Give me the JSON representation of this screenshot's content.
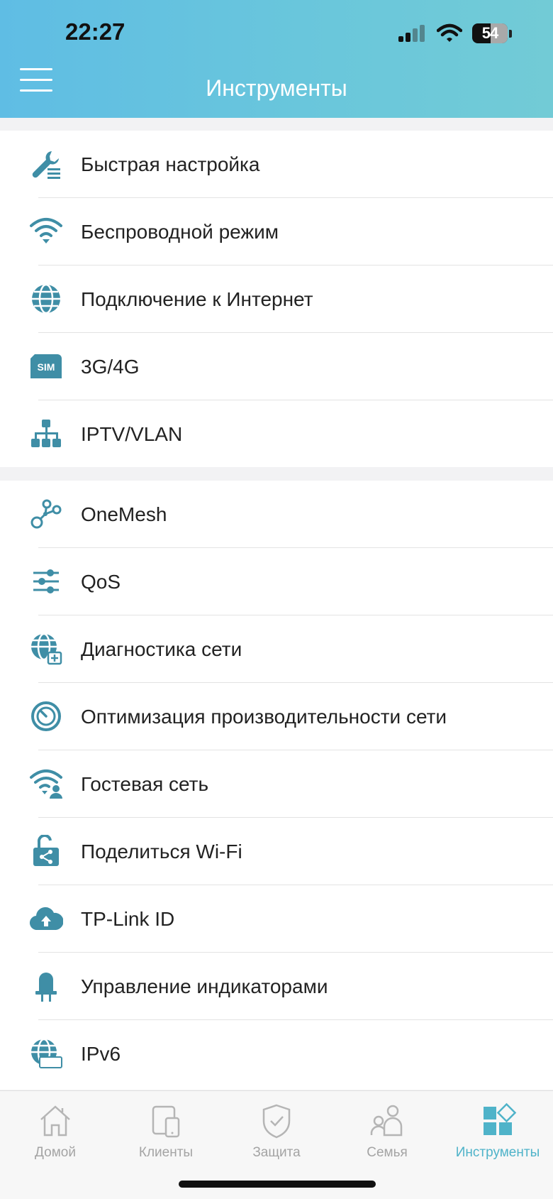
{
  "status_bar": {
    "time": "22:27",
    "battery": "54"
  },
  "header": {
    "title": "Инструменты"
  },
  "group1": [
    {
      "label": "Быстрая настройка",
      "icon": "wrench-settings-icon"
    },
    {
      "label": "Беспроводной режим",
      "icon": "wifi-icon"
    },
    {
      "label": "Подключение к Интернет",
      "icon": "globe-icon"
    },
    {
      "label": "3G/4G",
      "icon": "sim-card-icon"
    },
    {
      "label": "IPTV/VLAN",
      "icon": "network-tree-icon"
    }
  ],
  "group2": [
    {
      "label": "OneMesh",
      "icon": "mesh-nodes-icon"
    },
    {
      "label": "QoS",
      "icon": "sliders-icon"
    },
    {
      "label": "Диагностика сети",
      "icon": "globe-diagnostic-icon"
    },
    {
      "label": "Оптимизация производительности сети",
      "icon": "gauge-icon"
    },
    {
      "label": "Гостевая сеть",
      "icon": "guest-wifi-icon"
    },
    {
      "label": "Поделиться Wi-Fi",
      "icon": "share-lock-icon"
    },
    {
      "label": "TP-Link ID",
      "icon": "cloud-upload-icon"
    },
    {
      "label": "Управление индикаторами",
      "icon": "led-icon"
    },
    {
      "label": "IPv6",
      "icon": "ipv6-globe-icon"
    }
  ],
  "tabs": [
    {
      "label": "Домой",
      "icon": "home-icon",
      "active": false
    },
    {
      "label": "Клиенты",
      "icon": "devices-icon",
      "active": false
    },
    {
      "label": "Защита",
      "icon": "shield-icon",
      "active": false
    },
    {
      "label": "Семья",
      "icon": "family-icon",
      "active": false
    },
    {
      "label": "Инструменты",
      "icon": "tools-grid-icon",
      "active": true
    }
  ],
  "colors": {
    "accent": "#4a9bb3",
    "active_tab": "#4fb3c9",
    "header_start": "#5fbde4",
    "header_end": "#72cbd6"
  }
}
